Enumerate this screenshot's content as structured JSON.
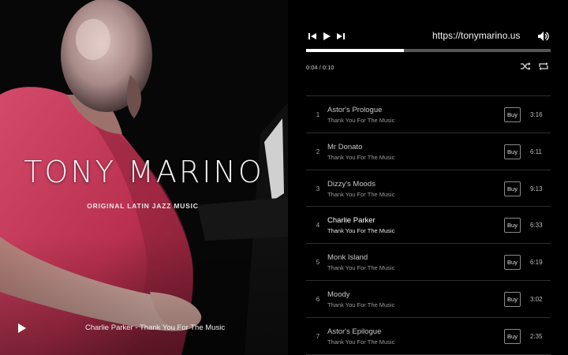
{
  "hero": {
    "title": "TONY MARINO",
    "subtitle": "ORIGINAL LATIN JAZZ MUSIC",
    "now_playing": "Charlie Parker - Thank You For The Music",
    "play_icon": "play-icon"
  },
  "player": {
    "url": "https://tonymarino.us",
    "time": "0:04 / 0:10",
    "progress_fraction": 0.4,
    "icons": {
      "prev": "skip-back-icon",
      "play": "play-icon",
      "next": "skip-forward-icon",
      "volume": "volume-icon",
      "shuffle": "shuffle-icon",
      "repeat": "repeat-icon"
    },
    "buy_label": "Buy",
    "tracks": [
      {
        "num": "1",
        "title": "Astor's Prologue",
        "album": "Thank You For The Music",
        "duration": "3:16"
      },
      {
        "num": "2",
        "title": "Mr Donato",
        "album": "Thank You For The Music",
        "duration": "6:11"
      },
      {
        "num": "3",
        "title": "Dizzy's Moods",
        "album": "Thank You For The Music",
        "duration": "9:13"
      },
      {
        "num": "4",
        "title": "Charlie Parker",
        "album": "Thank You For The Music",
        "duration": "6:33"
      },
      {
        "num": "5",
        "title": "Monk Island",
        "album": "Thank You For The Music",
        "duration": "6:19"
      },
      {
        "num": "6",
        "title": "Moody",
        "album": "Thank You For The Music",
        "duration": "3:02"
      },
      {
        "num": "7",
        "title": "Astor's Epilogue",
        "album": "Thank You For The Music",
        "duration": "2:35"
      }
    ],
    "active_track_index": 3
  },
  "colors": {
    "background": "#000000",
    "hero_shirt": "#c23a5a",
    "progress_fill": "#ffffff",
    "progress_track": "#555555"
  }
}
